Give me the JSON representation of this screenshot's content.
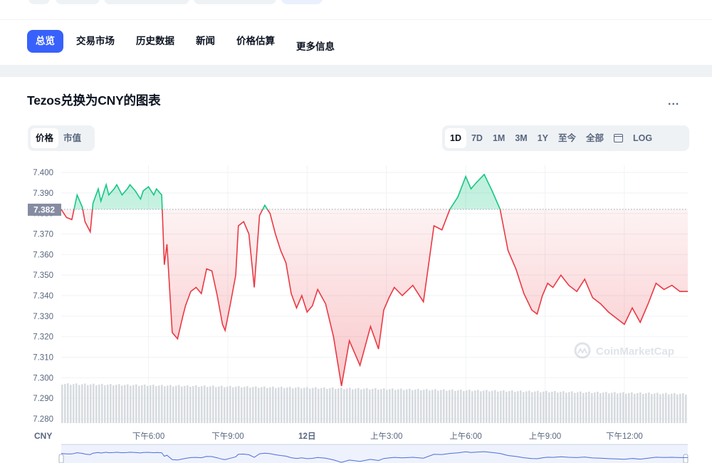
{
  "top_tabs": [
    "总览",
    "交易市场",
    "历史数据",
    "新闻",
    "价格估算",
    "更多信息"
  ],
  "chart_title": "Tezos兑换为CNY的图表",
  "more_menu": "...",
  "metric_toggle": [
    "价格",
    "市值"
  ],
  "ranges": [
    "1D",
    "7D",
    "1M",
    "3M",
    "1Y",
    "至今",
    "全部"
  ],
  "log_label": "LOG",
  "currency_label": "CNY",
  "watermark": "CoinMarketCap",
  "colors": {
    "up": "#16c784",
    "down": "#ea3943",
    "accent": "#3861fb",
    "volume": "#d7dbe0"
  },
  "chart_data": {
    "type": "line",
    "ylim": [
      7.28,
      7.4
    ],
    "y_ticks": [
      "7.400",
      "7.390",
      "7.380",
      "7.370",
      "7.360",
      "7.350",
      "7.340",
      "7.330",
      "7.320",
      "7.310",
      "7.300",
      "7.290",
      "7.280"
    ],
    "reference_value": 7.382,
    "reference_label": "7.382",
    "x_ticks": [
      "下午6:00",
      "下午9:00",
      "12日",
      "上午3:00",
      "上午6:00",
      "上午9:00",
      "下午12:00"
    ],
    "x_range_hours": [
      14.7,
      38.4
    ],
    "x_tick_hours": [
      18,
      21,
      24,
      27,
      30,
      33,
      36
    ],
    "series": [
      {
        "x_hours": [
          14.7,
          14.9,
          15.1,
          15.3,
          15.5,
          15.6,
          15.8,
          15.9,
          16.1,
          16.2,
          16.4,
          16.5,
          16.7,
          16.8,
          17.0,
          17.2,
          17.3,
          17.5,
          17.7,
          17.8,
          18.0,
          18.2,
          18.3,
          18.5,
          18.6,
          18.7,
          18.9,
          19.1,
          19.3,
          19.4,
          19.6,
          19.8,
          20.0,
          20.2,
          20.4,
          20.6,
          20.8,
          20.9,
          21.1,
          21.3,
          21.4,
          21.6,
          21.8,
          22.0,
          22.2,
          22.4,
          22.6,
          22.8,
          23.0,
          23.2,
          23.4,
          23.6,
          23.8,
          24.0,
          24.2,
          24.4,
          24.7,
          25.0,
          25.3,
          25.6,
          26.0,
          26.4,
          26.7,
          26.9,
          27.1,
          27.3,
          27.6,
          28.0,
          28.4,
          28.8,
          29.1,
          29.4,
          29.7,
          30.0,
          30.2,
          30.4,
          30.7,
          31.0,
          31.3,
          31.6,
          31.9,
          32.2,
          32.5,
          32.7,
          32.9,
          33.1,
          33.3,
          33.6,
          33.9,
          34.2,
          34.5,
          34.8,
          35.1,
          35.4,
          35.7,
          36.0,
          36.3,
          36.6,
          36.9,
          37.2,
          37.5,
          37.8,
          38.1,
          38.4
        ],
        "values": [
          7.382,
          7.378,
          7.377,
          7.389,
          7.383,
          7.376,
          7.371,
          7.385,
          7.392,
          7.386,
          7.394,
          7.389,
          7.392,
          7.394,
          7.389,
          7.392,
          7.394,
          7.391,
          7.387,
          7.391,
          7.393,
          7.389,
          7.392,
          7.389,
          7.355,
          7.365,
          7.322,
          7.319,
          7.33,
          7.335,
          7.342,
          7.344,
          7.341,
          7.353,
          7.352,
          7.34,
          7.326,
          7.323,
          7.336,
          7.35,
          7.374,
          7.376,
          7.37,
          7.344,
          7.379,
          7.384,
          7.38,
          7.37,
          7.362,
          7.356,
          7.341,
          7.334,
          7.34,
          7.332,
          7.335,
          7.343,
          7.336,
          7.32,
          7.296,
          7.318,
          7.306,
          7.325,
          7.314,
          7.333,
          7.339,
          7.344,
          7.34,
          7.345,
          7.337,
          7.374,
          7.372,
          7.382,
          7.388,
          7.398,
          7.392,
          7.395,
          7.399,
          7.391,
          7.382,
          7.362,
          7.353,
          7.341,
          7.333,
          7.331,
          7.34,
          7.346,
          7.344,
          7.35,
          7.345,
          7.342,
          7.348,
          7.339,
          7.336,
          7.332,
          7.329,
          7.326,
          7.334,
          7.327,
          7.336,
          7.346,
          7.343,
          7.345,
          7.342,
          7.342
        ],
        "colors_by_reference": true
      }
    ],
    "volume": "bars shown below the price line (no numeric labels)"
  }
}
